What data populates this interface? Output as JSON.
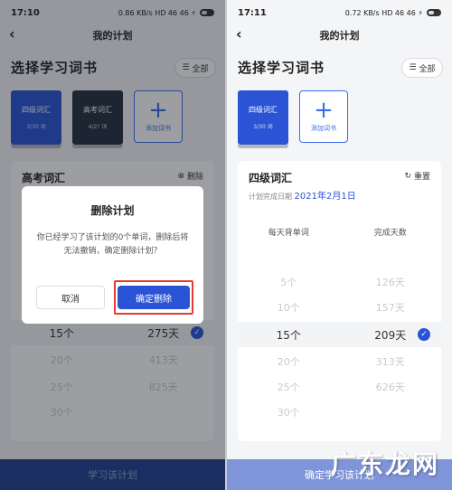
{
  "left": {
    "status_time": "17:10",
    "status_icons": "0.86 KB/s HD 46 46 ⚡",
    "header_title": "我的计划",
    "section_title": "选择学习词书",
    "all_label": "全部",
    "books": [
      {
        "name": "四级词汇",
        "count": "3/30 词"
      },
      {
        "name": "高考词汇",
        "count": "4/2? 词"
      }
    ],
    "add_book_label": "添加词书",
    "card_title": "高考词汇",
    "card_action": "删除",
    "rows": [
      {
        "words": "15个",
        "days": "275天",
        "selected": true
      },
      {
        "words": "20个",
        "days": "413天",
        "selected": false
      },
      {
        "words": "25个",
        "days": "825天",
        "selected": false
      },
      {
        "words": "30个",
        "days": "",
        "selected": false
      }
    ],
    "bottom_btn": "学习该计划",
    "dialog": {
      "title": "删除计划",
      "message": "你已经学习了该计划的0个单词，删除后将无法撤销，确定删除计划？",
      "cancel": "取消",
      "confirm": "确定删除"
    }
  },
  "right": {
    "status_time": "17:11",
    "status_icons": "0.72 KB/s HD 46 46 ⚡",
    "header_title": "我的计划",
    "section_title": "选择学习词书",
    "all_label": "全部",
    "book": {
      "name": "四级词汇",
      "count": "3/30 词"
    },
    "add_book_label": "添加词书",
    "card_title": "四级词汇",
    "card_action": "重置",
    "finish_prefix": "计划完成日期",
    "finish_date": "2021年2月1日",
    "col_words": "每天背单词",
    "col_days": "完成天数",
    "rows": [
      {
        "words": "5个",
        "days": "126天",
        "selected": false
      },
      {
        "words": "10个",
        "days": "157天",
        "selected": false
      },
      {
        "words": "15个",
        "days": "209天",
        "selected": true
      },
      {
        "words": "20个",
        "days": "313天",
        "selected": false
      },
      {
        "words": "25个",
        "days": "626天",
        "selected": false
      },
      {
        "words": "30个",
        "days": "",
        "selected": false
      }
    ],
    "bottom_btn": "确定学习该计划"
  },
  "watermark": "广东龙网",
  "colors": {
    "accent": "#2a53d6",
    "highlight": "#e53935"
  }
}
